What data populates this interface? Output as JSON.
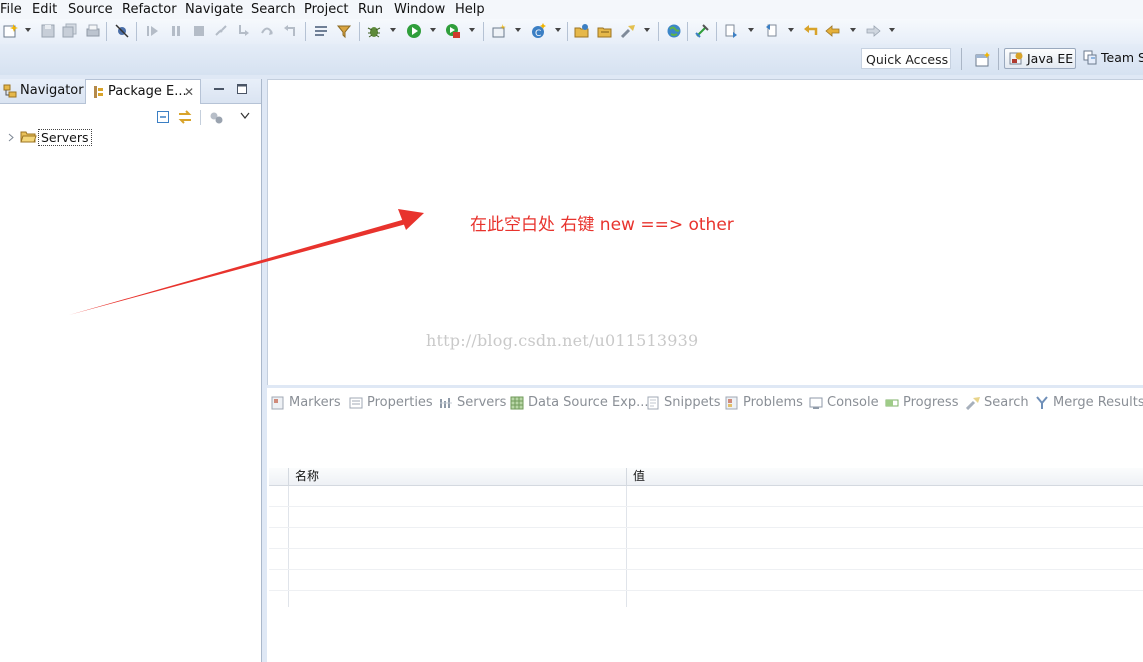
{
  "menu": [
    "File",
    "Edit",
    "Source",
    "Refactor",
    "Navigate",
    "Search",
    "Project",
    "Run",
    "Window",
    "Help"
  ],
  "quick_access": {
    "placeholder": "Quick Access"
  },
  "perspectives": {
    "java_ee": "Java EE",
    "team": "Team S"
  },
  "left_view": {
    "tabs": {
      "navigator": "Navigator",
      "package_explorer": "Package E..."
    },
    "close_glyph": "✕",
    "tree": [
      {
        "label": "Servers",
        "icon": "folder-icon",
        "expanded": false
      }
    ]
  },
  "editor": {
    "annotation": "在此空白处 右键  new ==> other",
    "watermark": "http://blog.csdn.net/u011513939",
    "annotation_color": "#e8332d"
  },
  "bottom_view": {
    "tabs": [
      "Markers",
      "Properties",
      "Servers",
      "Data Source Exp...",
      "Snippets",
      "Problems",
      "Console",
      "Progress",
      "Search",
      "Merge Results"
    ],
    "table": {
      "columns": [
        "名称",
        "值"
      ],
      "rows": 6
    }
  },
  "colors": {
    "chrome": "#dfe8f5",
    "accent": "#e8332d"
  }
}
